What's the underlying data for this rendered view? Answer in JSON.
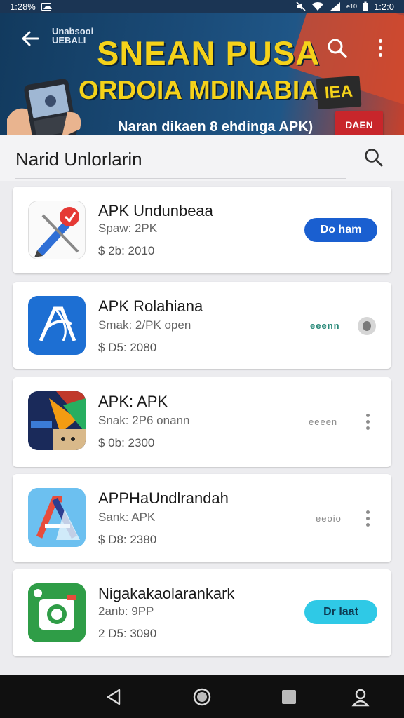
{
  "status_bar": {
    "time_left": "1:28%",
    "small_label": "e10",
    "time_right": "1:2:0"
  },
  "banner": {
    "brand_line1": "Unabsooi",
    "brand_line2": "UEBALI",
    "title1": "SNEAN PUSA",
    "title2": "ORDOIA MDINABIA",
    "badge": "IEA",
    "subtitle": "Naran dikaen 8 ehdinga APK)",
    "red_button": "DAEN"
  },
  "section": {
    "title": "Narid Unlorlarin"
  },
  "apps": [
    {
      "name": "APK Undunbeaa",
      "size": "Spaw: 2PK",
      "price": "$ 2b: 2010",
      "action": "Do ham",
      "action_type": "button",
      "action_color": "#1a5fd0"
    },
    {
      "name": "APK Rolahiana",
      "size": "Smak: 2/PK open",
      "price": "$ D5: 2080",
      "action": "eeenn",
      "action_type": "progress-teal"
    },
    {
      "name": "APK: APK",
      "size": "Snak: 2P6 onann",
      "price": "$ 0b: 2300",
      "action": "eeeen",
      "action_type": "progress-grey"
    },
    {
      "name": "APPHaUndlrandah",
      "size": "Sank: APK",
      "price": "$ D8: 2380",
      "action": "eeoio",
      "action_type": "progress-grey"
    },
    {
      "name": "Nigakakaolarankark",
      "size": "2anb: 9PP",
      "price": "2 D5: 3090",
      "action": "Dr laat",
      "action_type": "button",
      "action_color": "#2fc9e6"
    }
  ],
  "colors": {
    "banner_blue": "#1a4b78",
    "banner_yellow": "#f5d21a",
    "primary_button": "#1a5fd0",
    "teal_button": "#2fc9e6",
    "nav_bar": "#101010"
  }
}
